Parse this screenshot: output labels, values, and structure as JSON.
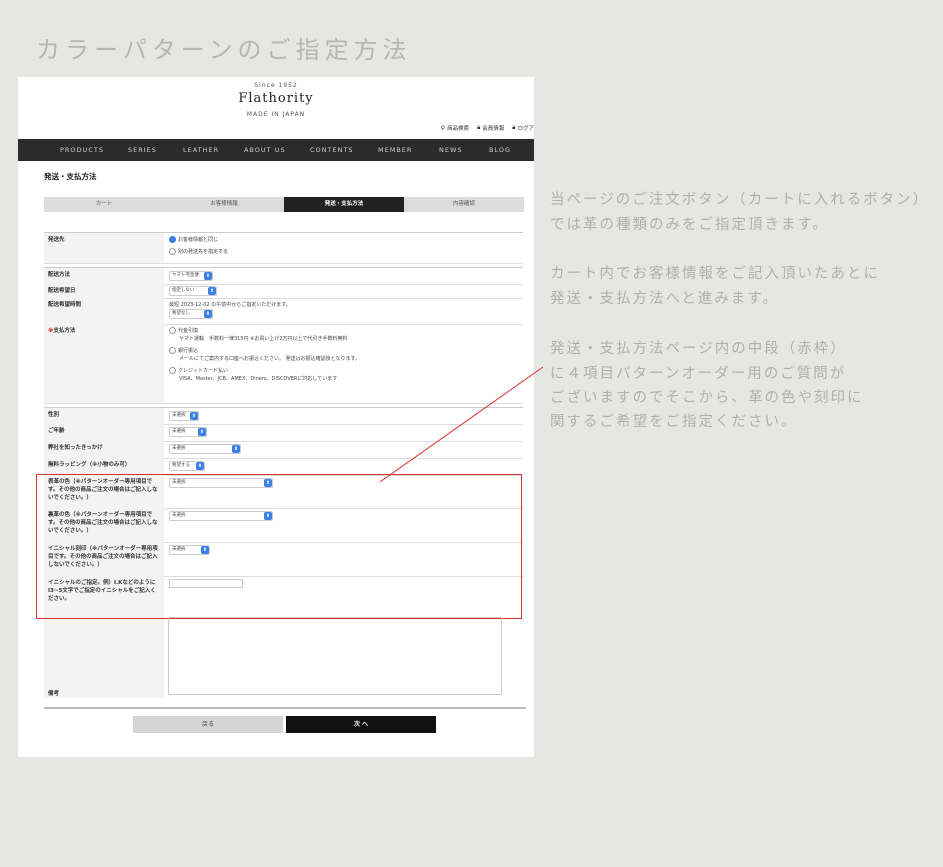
{
  "heading": "カラーパターンのご指定方法",
  "site": {
    "since": "Since 1952",
    "logo": "Flathority",
    "made": "MADE IN JAPAN",
    "util": [
      {
        "icon": "search-icon",
        "label": "商品検索"
      },
      {
        "icon": "lock-icon",
        "label": "会員情報"
      },
      {
        "icon": "lock-icon",
        "label": "ログア"
      }
    ],
    "nav": [
      "PRODUCTS",
      "SERIES",
      "LEATHER",
      "ABOUT US",
      "CONTENTS",
      "MEMBER",
      "NEWS",
      "BLOG"
    ],
    "page_title": "発送・支払方法",
    "steps": [
      "カート",
      "お客様情報",
      "発送・支払方法",
      "内容確認"
    ],
    "dest_label": "発送先",
    "dest_opt1": "お客様情報と同じ",
    "dest_opt2": "別の発送先を指定する",
    "ship_method_label": "配送方法",
    "ship_method_val": "ヤマト宅急便",
    "ship_date_label": "配送希望日",
    "ship_date_val": "指定しない",
    "ship_time_label": "配送希望時間",
    "ship_time_note": "最短 2023-12-02 の午前中からご指定いただけます。",
    "ship_time_val": "希望なし",
    "pay_label": "支払方法",
    "pay_req": "※",
    "pay_opts": [
      {
        "title": "代金引換",
        "desc": "ヤマト運輸　手数料一律315円 ※お買い上げ2万円以上で代引き手数料無料"
      },
      {
        "title": "銀行振込",
        "desc": "メールにてご案内する口座へお振込ください。 発送はお振込確認後となります。"
      },
      {
        "title": "クレジットカード払い",
        "desc": "VISA、Master、JCB、AMEX、Diners、DISCOVERに対応しています"
      }
    ],
    "gender_label": "性別",
    "gender_val": "未選択",
    "age_label": "ご年齢",
    "age_val": "未選択",
    "source_label": "弊社を知ったきっかけ",
    "source_val": "未選択",
    "wrap_label": "無料ラッピング（※小物のみ可）",
    "wrap_val": "希望する",
    "front_label": "表革の色（※パターンオーダー専用項目です。その他の商品ご注文の場合はご記入しないでください。）",
    "front_val": "未選択",
    "back_label": "裏革の色（※パターンオーダー専用項目です。その他の商品ご注文の場合はご記入しないでください。）",
    "back_val": "未選択",
    "initial_label": "イニシャル刻印（※パターンオーダー専用項目です。その他の商品ご注文の場合はご記入しないでください。）",
    "initial_val": "未選択",
    "initial_text_label": "イニシャルのご指定。例）I.KなどのようにI3~5文字でご指定のイニシャルをご記入ください。",
    "biko_label": "備考",
    "btn_back": "戻る",
    "btn_next": "次 へ"
  },
  "explanation": [
    "当ページのご注文ボタン（カートに入れるボタン）",
    "では革の種類のみをご指定頂きます。",
    "",
    "カート内でお客様情報をご記入頂いたあとに",
    "発送・支払方法へと進みます。",
    "",
    "発送・支払方法ページ内の中段（赤枠）",
    "に４項目パターンオーダー用のご質問が",
    "ございますのでそこから、革の色や刻印に",
    "関するご希望をご指定ください。"
  ],
  "colors": {
    "highlight": "#d9322e",
    "nav_bg": "#2b2b2b",
    "select_blue": "#3b7ee6"
  }
}
